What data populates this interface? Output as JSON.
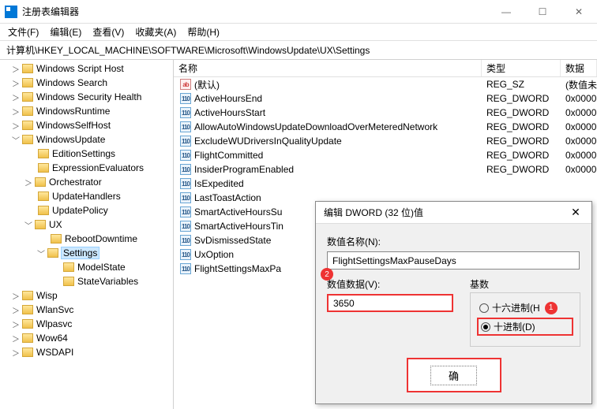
{
  "window": {
    "title": "注册表编辑器"
  },
  "menu": {
    "file": "文件(F)",
    "edit": "编辑(E)",
    "view": "查看(V)",
    "fav": "收藏夹(A)",
    "help": "帮助(H)"
  },
  "address": "计算机\\HKEY_LOCAL_MACHINE\\SOFTWARE\\Microsoft\\WindowsUpdate\\UX\\Settings",
  "tree": [
    {
      "pad": 14,
      "t": ">",
      "n": "Windows Script Host"
    },
    {
      "pad": 14,
      "t": ">",
      "n": "Windows Search"
    },
    {
      "pad": 14,
      "t": ">",
      "n": "Windows Security Health"
    },
    {
      "pad": 14,
      "t": ">",
      "n": "WindowsRuntime"
    },
    {
      "pad": 14,
      "t": ">",
      "n": "WindowsSelfHost"
    },
    {
      "pad": 14,
      "t": "v",
      "n": "WindowsUpdate"
    },
    {
      "pad": 34,
      "t": "",
      "n": "EditionSettings"
    },
    {
      "pad": 34,
      "t": "",
      "n": "ExpressionEvaluators"
    },
    {
      "pad": 30,
      "t": ">",
      "n": "Orchestrator"
    },
    {
      "pad": 34,
      "t": "",
      "n": "UpdateHandlers"
    },
    {
      "pad": 34,
      "t": "",
      "n": "UpdatePolicy"
    },
    {
      "pad": 30,
      "t": "v",
      "n": "UX"
    },
    {
      "pad": 50,
      "t": "",
      "n": "RebootDowntime"
    },
    {
      "pad": 46,
      "t": "v",
      "n": "Settings",
      "sel": true
    },
    {
      "pad": 66,
      "t": "",
      "n": "ModelState"
    },
    {
      "pad": 66,
      "t": "",
      "n": "StateVariables"
    },
    {
      "pad": 14,
      "t": ">",
      "n": "Wisp"
    },
    {
      "pad": 14,
      "t": ">",
      "n": "WlanSvc"
    },
    {
      "pad": 14,
      "t": ">",
      "n": "Wlpasvc"
    },
    {
      "pad": 14,
      "t": ">",
      "n": "Wow64"
    },
    {
      "pad": 14,
      "t": ">",
      "n": "WSDAPI"
    }
  ],
  "columns": {
    "name": "名称",
    "type": "类型",
    "data": "数据"
  },
  "rows": [
    {
      "icon": "str",
      "n": "(默认)",
      "t": "REG_SZ",
      "d": "(数值未"
    },
    {
      "icon": "bin",
      "n": "ActiveHoursEnd",
      "t": "REG_DWORD",
      "d": "0x0000"
    },
    {
      "icon": "bin",
      "n": "ActiveHoursStart",
      "t": "REG_DWORD",
      "d": "0x0000"
    },
    {
      "icon": "bin",
      "n": "AllowAutoWindowsUpdateDownloadOverMeteredNetwork",
      "t": "REG_DWORD",
      "d": "0x0000"
    },
    {
      "icon": "bin",
      "n": "ExcludeWUDriversInQualityUpdate",
      "t": "REG_DWORD",
      "d": "0x0000"
    },
    {
      "icon": "bin",
      "n": "FlightCommitted",
      "t": "REG_DWORD",
      "d": "0x0000"
    },
    {
      "icon": "bin",
      "n": "InsiderProgramEnabled",
      "t": "REG_DWORD",
      "d": "0x0000"
    },
    {
      "icon": "bin",
      "n": "IsExpedited",
      "t": "",
      "d": ""
    },
    {
      "icon": "bin",
      "n": "LastToastAction",
      "t": "",
      "d": ""
    },
    {
      "icon": "bin",
      "n": "SmartActiveHoursSu",
      "t": "",
      "d": ""
    },
    {
      "icon": "bin",
      "n": "SmartActiveHoursTin",
      "t": "",
      "d": ""
    },
    {
      "icon": "bin",
      "n": "SvDismissedState",
      "t": "",
      "d": ""
    },
    {
      "icon": "bin",
      "n": "UxOption",
      "t": "",
      "d": ""
    },
    {
      "icon": "bin",
      "n": "FlightSettingsMaxPa",
      "t": "",
      "d": ""
    }
  ],
  "dialog": {
    "title": "编辑 DWORD (32 位)值",
    "name_label": "数值名称(N):",
    "name_value": "FlightSettingsMaxPauseDays",
    "data_label": "数值数据(V):",
    "data_value": "3650",
    "base_label": "基数",
    "hex": "十六进制(H",
    "dec": "十进制(D)",
    "ok": "确",
    "marker1": "1",
    "marker2": "2"
  }
}
